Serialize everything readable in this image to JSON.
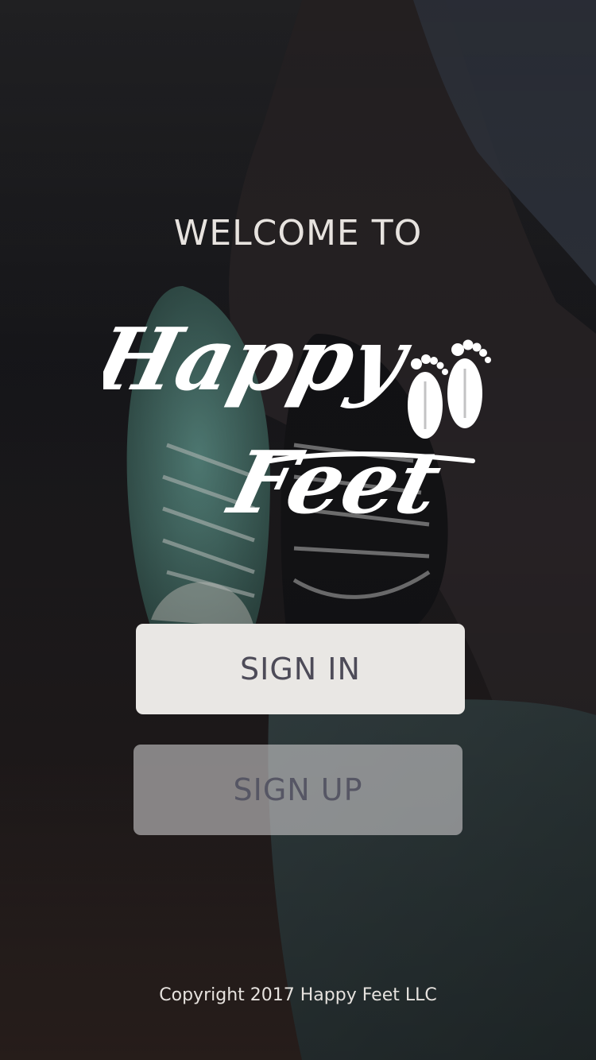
{
  "welcome": {
    "heading": "WELCOME TO"
  },
  "logo": {
    "word1": "Happy",
    "word2": "Feet",
    "icon": "footprints-icon"
  },
  "buttons": {
    "sign_in": "SIGN IN",
    "sign_up": "SIGN UP"
  },
  "footer": {
    "copyright": "Copyright 2017 Happy Feet LLC"
  },
  "colors": {
    "text_light": "#e7e3df",
    "button_primary_bg": "#e9e7e4",
    "button_text": "#4d4b58"
  }
}
